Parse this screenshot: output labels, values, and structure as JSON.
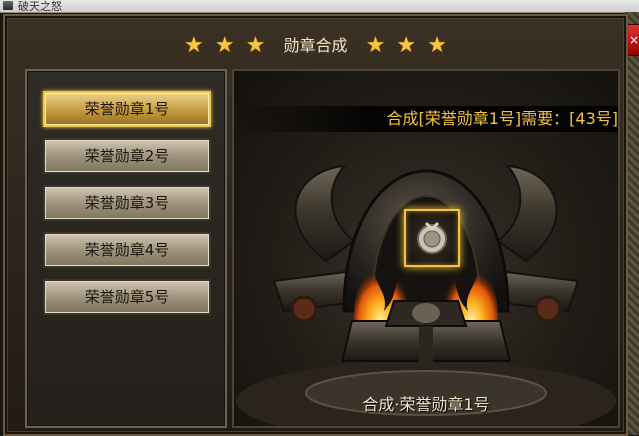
{
  "window": {
    "title": "破天之怒"
  },
  "header": {
    "title": "勋章合成",
    "stars_left": [
      "★",
      "★",
      "★"
    ],
    "stars_right": [
      "★",
      "★",
      "★"
    ]
  },
  "medal_list": [
    {
      "label": "荣誉勋章1号",
      "active": true
    },
    {
      "label": "荣誉勋章2号",
      "active": false
    },
    {
      "label": "荣誉勋章3号",
      "active": false
    },
    {
      "label": "荣誉勋章4号",
      "active": false
    },
    {
      "label": "荣誉勋章5号",
      "active": false
    }
  ],
  "synthesis": {
    "requirement_text": "合成[荣誉勋章1号]需要：[43号]",
    "button_label": "合成·荣誉勋章1号",
    "slot_icon": "medal-icon"
  },
  "colors": {
    "gold": "#f4c247",
    "active_border": "#f3c642",
    "close": "#cc2222"
  }
}
